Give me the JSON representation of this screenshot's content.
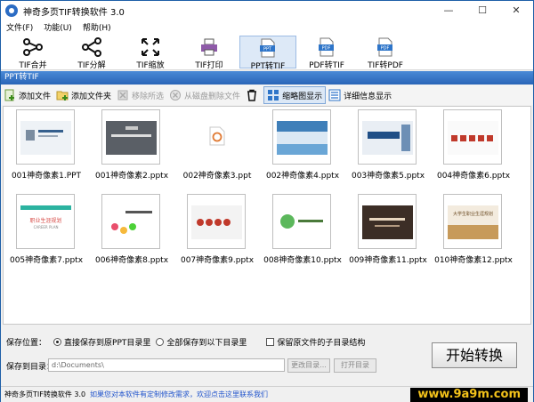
{
  "app": {
    "title": "神奇多页TIF转换软件 3.0",
    "window_buttons": [
      "—",
      "☐",
      "✕"
    ]
  },
  "menu": [
    "文件(F)",
    "功能(U)",
    "帮助(H)"
  ],
  "toolbar": [
    {
      "label": "TIF合并",
      "icon": "merge-icon"
    },
    {
      "label": "TIF分解",
      "icon": "split-icon"
    },
    {
      "label": "TIF缩放",
      "icon": "zoom-icon"
    },
    {
      "label": "TIF打印",
      "icon": "printer-icon"
    },
    {
      "label": "PPT转TIF",
      "icon": "ppt-file-icon",
      "active": true,
      "badge": "PPT"
    },
    {
      "label": "PDF转TIF",
      "icon": "pdf-file-icon",
      "badge": "PDF"
    },
    {
      "label": "TIF转PDF",
      "icon": "pdf-file-icon",
      "badge": "PDF"
    }
  ],
  "section_title": "PPT转TIF",
  "actions": {
    "add_file": "添加文件",
    "add_folder": "添加文件夹",
    "remove_selected": "移除所选",
    "delete_from_disk": "从磁盘删除文件",
    "thumbnail_view": "缩略图显示",
    "detail_view": "详细信息显示"
  },
  "files": [
    "001神奇像素1.PPT",
    "001神奇像素2.pptx",
    "002神奇像素3.ppt",
    "002神奇像素4.pptx",
    "003神奇像素5.pptx",
    "004神奇像素6.pptx",
    "005神奇像素7.pptx",
    "006神奇像素8.pptx",
    "007神奇像素9.pptx",
    "008神奇像素10.pptx",
    "009神奇像素11.pptx",
    "010神奇像素12.pptx"
  ],
  "slide_texts": {
    "s7": "职业生涯规划",
    "s7b": "CAREER PLAN",
    "s2": "大学生职业生涯规划",
    "s11": "大学生职业生涯规划"
  },
  "save": {
    "position_label": "保存位置：",
    "opt_same": "直接保存到原PPT目录里",
    "opt_all": "全部保存到以下目录里",
    "opt_keep": "保留原文件的子目录结构",
    "dir_label": "保存到目录：",
    "dir_value": "d:\\Documents\\",
    "change_btn": "更改目录...",
    "open_btn": "打开目录",
    "start_btn": "开始转换"
  },
  "status": {
    "app": "神奇多页TIF转换软件 3.0",
    "notice": "如果您对本软件有定制修改需求，欢迎点击这里联系我们",
    "watermark": "www.9a9m.com"
  }
}
